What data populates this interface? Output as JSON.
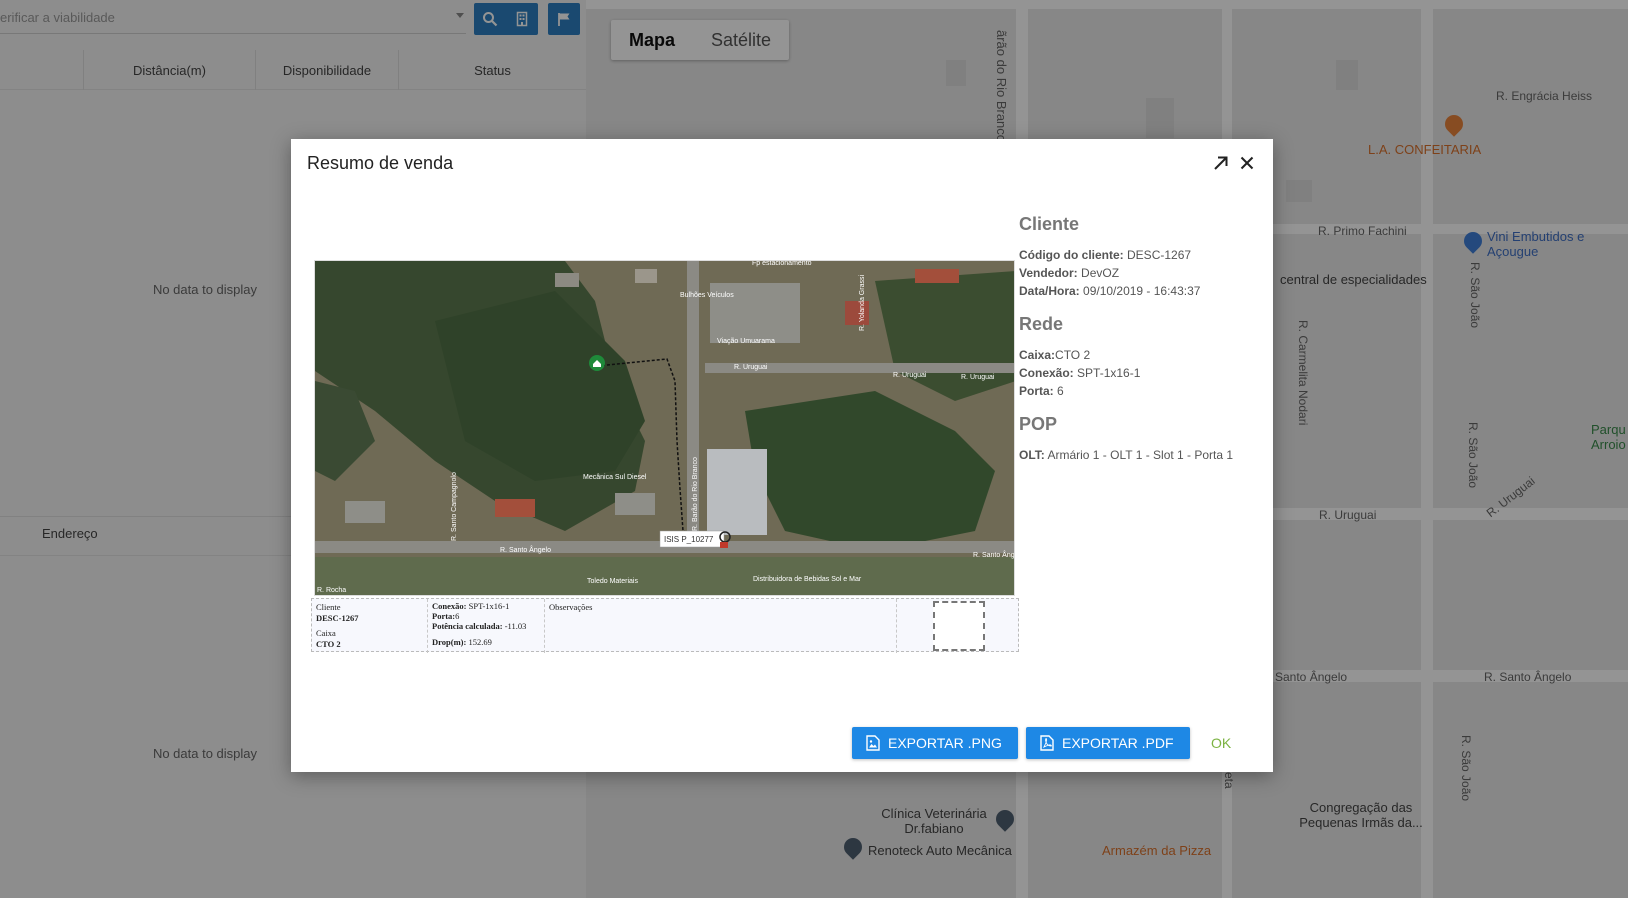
{
  "left_panel": {
    "search": {
      "placeholder": "erificar a viabilidade",
      "search_icon": "search-icon",
      "building_icon": "building-icon",
      "flag_icon": "flag-icon",
      "accent": "#2d7fc1"
    },
    "columns": [
      "Distância(m)",
      "Disponibilidade",
      "Status"
    ],
    "empty_top": "No data to display",
    "address_header": "Endereço",
    "empty_bottom": "No data to display"
  },
  "map": {
    "tabs": [
      "Mapa",
      "Satélite"
    ],
    "active_tab": "Mapa",
    "street_labels": {
      "rio_branco": "ãrão do Rio Branco",
      "engracia": "R. Engrácia Heiss",
      "primo": "R. Primo Fachini",
      "carmelita": "R. Carmelita Nodari",
      "sao_joao_1": "R. São João",
      "sao_joao_2": "R. São João",
      "sao_joao_3": "R. São João",
      "uruguai_1": "R. Uruguai",
      "uruguai_2": "R. Uruguai",
      "santo_angelo_1": "Santo Ângelo",
      "santo_angelo_2": "R. Santo Ângelo",
      "eta": "eta"
    },
    "pois": {
      "confeitaria": "L.A. CONFEITARIA",
      "vini": "Vini Embutidos e Açougue",
      "central": "central de especialidades",
      "parque": "Parqu Arroio",
      "clinica": "Clínica Veterinária Dr.fabiano",
      "renoteck": "Renoteck Auto Mecânica",
      "armazem": "Armazém da Pizza",
      "congregacao": "Congregação das Pequenas Irmãs da..."
    }
  },
  "dialog": {
    "title": "Resumo de venda",
    "expand_icon": "arrow-up-right-icon",
    "close_icon": "close-icon",
    "satellite": {
      "labels": {
        "estacionamento": "Fp estacionamento",
        "viacao": "Viação Umuarama",
        "mecanica": "Mecânica Sul Diesel",
        "uruguai_a": "R. Uruguai",
        "uruguai_b": "R. Uruguai",
        "uruguai_c": "R. Uruguai",
        "santo_angelo_a": "R. Santo Ângelo",
        "santo_angelo_b": "R. Santo Ânge",
        "distribuidora": "Distribuidora de Bebidas Sol e Mar",
        "rocha": "R. Rocha",
        "toledo": "Toledo Materiais",
        "veiculos": "Bulhões Veículos",
        "marker": "ISIS P_10277",
        "campagnolo": "R. Santo Campagnolo",
        "rio_branco": "R. Barão do Rio Branco",
        "yolanda": "R. Yolanda Grassi"
      }
    },
    "strip": {
      "cliente_label": "Cliente",
      "cliente_value": "DESC-1267",
      "caixa_label": "Caixa",
      "caixa_value": "CTO 2",
      "conexao_label": "Conexão:",
      "conexao_value": "SPT-1x16-1",
      "porta_label": "Porta:",
      "porta_value": "6",
      "potencia_label": "Potência calculada:",
      "potencia_value": "-11.03",
      "drop_label": "Drop(m):",
      "drop_value": "152.69",
      "observacoes": "Observações"
    },
    "info": {
      "cliente_heading": "Cliente",
      "codigo_label": "Código do cliente:",
      "codigo_value": "DESC-1267",
      "vendedor_label": "Vendedor:",
      "vendedor_value": "DevOZ",
      "data_label": "Data/Hora:",
      "data_value": "09/10/2019 - 16:43:37",
      "rede_heading": "Rede",
      "caixa_label": "Caixa:",
      "caixa_value": "CTO 2",
      "conexao_label": "Conexão:",
      "conexao_value": "SPT-1x16-1",
      "porta_label": "Porta:",
      "porta_value": "6",
      "pop_heading": "POP",
      "olt_label": "OLT:",
      "olt_value": "Armário 1 - OLT 1 - Slot 1 - Porta 1"
    },
    "buttons": {
      "export_png": "EXPORTAR .PNG",
      "export_pdf": "EXPORTAR .PDF",
      "ok": "OK",
      "export_icon": "image-file-icon",
      "pdf_icon": "pdf-file-icon",
      "button_color": "#1e88e5",
      "ok_color": "#7cb342"
    }
  }
}
